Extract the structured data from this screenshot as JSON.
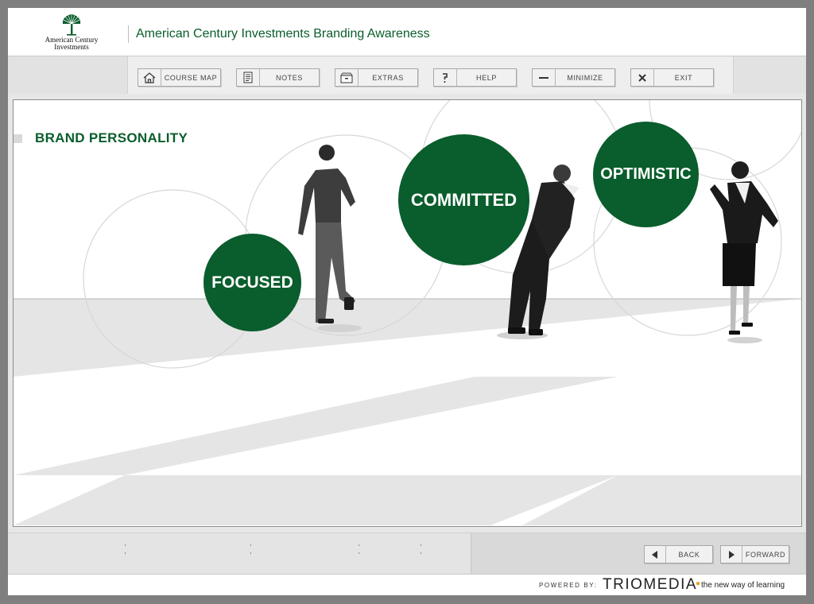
{
  "header": {
    "logo_line1": "American Century",
    "logo_line2": "Investments",
    "course_title": "American Century Investments Branding Awareness"
  },
  "toolbar": {
    "buttons": [
      {
        "label": "COURSE MAP",
        "icon": "home-icon"
      },
      {
        "label": "NOTES",
        "icon": "document-icon"
      },
      {
        "label": "EXTRAS",
        "icon": "drawer-icon"
      },
      {
        "label": "HELP",
        "icon": "question-icon"
      },
      {
        "label": "MINIMIZE",
        "icon": "minus-icon"
      },
      {
        "label": "EXIT",
        "icon": "close-icon"
      }
    ]
  },
  "content": {
    "section_title": "BRAND PERSONALITY",
    "traits": [
      "FOCUSED",
      "COMMITTED",
      "OPTIMISTIC"
    ],
    "trait_color": "#0a5d2c"
  },
  "footer": {
    "back_label": "BACK",
    "forward_label": "FORWARD",
    "back_icon": "triangle-left-icon",
    "forward_icon": "triangle-right-icon"
  },
  "branding": {
    "powered_by": "POWERED BY:",
    "vendor": "TRIOMEDIA",
    "tagline": "the new way of learning",
    "accent": "#e3a21a"
  },
  "colors": {
    "brand_green": "#0a5d2c",
    "frame_gray": "#7f7f7f"
  }
}
